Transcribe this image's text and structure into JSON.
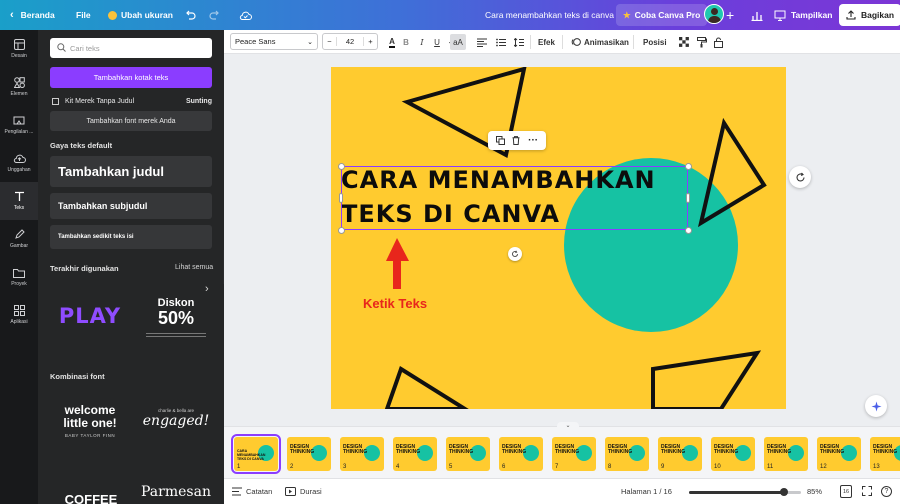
{
  "topbar": {
    "home": "Beranda",
    "file": "File",
    "resize": "Ubah ukuran",
    "doc_title": "Cara menambahkan teks di canva",
    "try_pro": "Coba Canva Pro",
    "present": "Tampilkan",
    "share": "Bagikan"
  },
  "rail": [
    {
      "label": "Desain",
      "icon": "layout-icon"
    },
    {
      "label": "Elemen",
      "icon": "shapes-icon"
    },
    {
      "label": "Pengilalan ...",
      "icon": "brand-icon"
    },
    {
      "label": "Unggahan",
      "icon": "cloud-upload-icon"
    },
    {
      "label": "Teks",
      "icon": "text-icon"
    },
    {
      "label": "Gambar",
      "icon": "draw-icon"
    },
    {
      "label": "Proyek",
      "icon": "folder-icon"
    },
    {
      "label": "Aplikasi",
      "icon": "apps-icon"
    }
  ],
  "panel": {
    "search_placeholder": "Cari teks",
    "add_textbox": "Tambahkan kotak teks",
    "brand_kit": "Kit Merek Tanpa Judul",
    "edit": "Sunting",
    "add_brand_font": "Tambahkan font merek Anda",
    "default_styles_title": "Gaya teks default",
    "heading": "Tambahkan judul",
    "subheading": "Tambahkan subjudul",
    "body": "Tambahkan sedikit teks isi",
    "recent_title": "Terakhir digunakan",
    "see_all": "Lihat semua",
    "recent_1": "PLAY",
    "recent_2_top": "Diskon",
    "recent_2_big": "50%",
    "combo_title": "Kombinasi font",
    "combo_1_line1": "welcome",
    "combo_1_line2": "little one!",
    "combo_1_sub": "BABY TAYLOR FINN",
    "combo_2_small": "charlie & bella are",
    "combo_2_main": "engaged!",
    "combo_3": "COFFEE",
    "combo_4": "Parmesan"
  },
  "toolbar": {
    "font": "Peace Sans",
    "size": "42",
    "effects": "Efek",
    "animate": "Animasikan",
    "position": "Posisi"
  },
  "canvas": {
    "headline_line1": "CARA MENAMBAHKAN",
    "headline_line2": "TEKS DI CANVA",
    "annotation": "Ketik Teks",
    "colors": {
      "background": "#ffcb2f",
      "circle": "#16c2a3",
      "arrow": "#e8261c",
      "selection": "#8b3dff"
    }
  },
  "filmstrip": {
    "thumbs": [
      {
        "num": "1",
        "text": "CARA MENAMBAHKAN TEKS DI CANVA"
      },
      {
        "num": "2",
        "text": "DESIGN THINKING"
      },
      {
        "num": "3",
        "text": "DESIGN THINKING"
      },
      {
        "num": "4",
        "text": "DESIGN THINKING"
      },
      {
        "num": "5",
        "text": "DESIGN THINKING"
      },
      {
        "num": "6",
        "text": "DESIGN THINKING"
      },
      {
        "num": "7",
        "text": "DESIGN THINKING"
      },
      {
        "num": "8",
        "text": "DESIGN THINKING"
      },
      {
        "num": "9",
        "text": "DESIGN THINKING"
      },
      {
        "num": "10",
        "text": "DESIGN THINKING"
      },
      {
        "num": "11",
        "text": "DESIGN THINKING"
      },
      {
        "num": "12",
        "text": "DESIGN THINKING"
      },
      {
        "num": "13",
        "text": "DESIGN THINKING"
      }
    ]
  },
  "bottombar": {
    "notes": "Catatan",
    "duration": "Durasi",
    "page": "Halaman 1 / 16",
    "zoom": "85%",
    "zoom_level": 0.85,
    "page_count": "16"
  }
}
